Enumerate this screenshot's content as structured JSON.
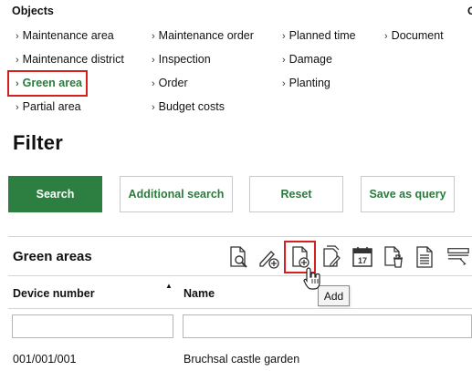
{
  "objects": {
    "title": "Objects",
    "edge_glyph": "C",
    "items": [
      {
        "label": "Maintenance area"
      },
      {
        "label": "Maintenance district"
      },
      {
        "label": "Green area"
      },
      {
        "label": "Partial area"
      },
      {
        "label": "Maintenance order"
      },
      {
        "label": "Inspection"
      },
      {
        "label": "Order"
      },
      {
        "label": "Budget costs"
      },
      {
        "label": "Planned time"
      },
      {
        "label": "Damage"
      },
      {
        "label": "Planting"
      },
      {
        "label": "Document"
      }
    ],
    "chevron": "›"
  },
  "filter": {
    "title": "Filter",
    "buttons": {
      "search": "Search",
      "additional_search": "Additional search",
      "reset": "Reset",
      "save_as_query": "Save as query"
    }
  },
  "green_areas": {
    "title": "Green areas",
    "toolbar": [
      "search-document-icon",
      "edit-add-icon",
      "add-document-icon",
      "copy-edit-icon",
      "calendar-icon",
      "delete-document-icon",
      "list-document-icon",
      "overflow-menu-icon"
    ],
    "calendar_day": "17",
    "tooltip": "Add",
    "columns": {
      "device_number": "Device number",
      "name": "Name"
    },
    "sort_indicator": "▲",
    "filters": {
      "device_number": "",
      "name": ""
    },
    "rows": [
      {
        "device_number": "001/001/001",
        "name": "Bruchsal castle garden"
      }
    ]
  },
  "colors": {
    "accent_green": "#2d7f41",
    "highlight_red": "#d42020"
  }
}
